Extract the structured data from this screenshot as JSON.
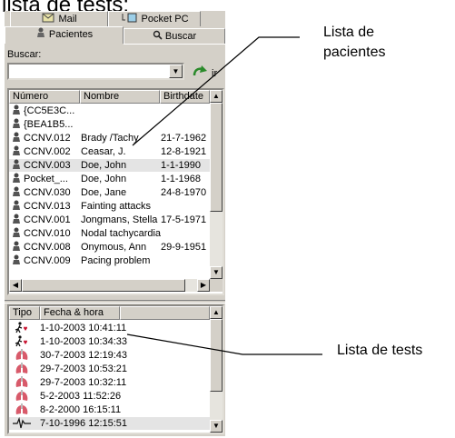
{
  "heading": "lista de tests:",
  "tabs": {
    "mail": "Mail",
    "pocket_pc": "Pocket PC",
    "pacientes": "Pacientes",
    "buscar": "Buscar"
  },
  "search": {
    "label": "Buscar:",
    "value": ""
  },
  "patients": {
    "columns": [
      "Número",
      "Nombre",
      "Birthdate"
    ],
    "rows": [
      {
        "numero": "{CC5E3C...",
        "nombre": "",
        "birthdate": ""
      },
      {
        "numero": "{BEA1B5...",
        "nombre": "",
        "birthdate": ""
      },
      {
        "numero": "CCNV.012",
        "nombre": "Brady /Tachy",
        "birthdate": "21-7-1962"
      },
      {
        "numero": "CCNV.002",
        "nombre": "Ceasar, J.",
        "birthdate": "12-8-1921"
      },
      {
        "numero": "CCNV.003",
        "nombre": "Doe, John",
        "birthdate": "1-1-1990"
      },
      {
        "numero": "Pocket_...",
        "nombre": "Doe, John",
        "birthdate": "1-1-1968"
      },
      {
        "numero": "CCNV.030",
        "nombre": "Doe, Jane",
        "birthdate": "24-8-1970"
      },
      {
        "numero": "CCNV.013",
        "nombre": "Fainting attacks",
        "birthdate": ""
      },
      {
        "numero": "CCNV.001",
        "nombre": "Jongmans, Stella",
        "birthdate": "17-5-1971"
      },
      {
        "numero": "CCNV.010",
        "nombre": "Nodal tachycardia",
        "birthdate": ""
      },
      {
        "numero": "CCNV.008",
        "nombre": "Onymous, Ann",
        "birthdate": "29-9-1951"
      },
      {
        "numero": "CCNV.009",
        "nombre": "Pacing problem",
        "birthdate": ""
      }
    ]
  },
  "tests": {
    "columns": [
      "Tipo",
      "Fecha & hora"
    ],
    "rows": [
      {
        "icon": "runner-icon",
        "datetime": "1-10-2003 10:41:11"
      },
      {
        "icon": "runner-icon",
        "datetime": "1-10-2003 10:34:33"
      },
      {
        "icon": "lungs-icon",
        "datetime": "30-7-2003 12:19:43"
      },
      {
        "icon": "lungs-icon",
        "datetime": "29-7-2003 10:53:21"
      },
      {
        "icon": "lungs-icon",
        "datetime": "29-7-2003 10:32:11"
      },
      {
        "icon": "lungs-icon",
        "datetime": "5-2-2003 11:52:26"
      },
      {
        "icon": "lungs-icon",
        "datetime": "8-2-2000 16:15:11"
      },
      {
        "icon": "ecg-icon",
        "datetime": "7-10-1996 12:15:51"
      }
    ]
  },
  "callouts": {
    "pacientes_line1": "Lista de",
    "pacientes_line2": "pacientes",
    "tests": "Lista de tests"
  },
  "colors": {
    "window_bg": "#d4d0c8",
    "selection": "#e4e4e4",
    "icon_red": "#c8102e"
  }
}
